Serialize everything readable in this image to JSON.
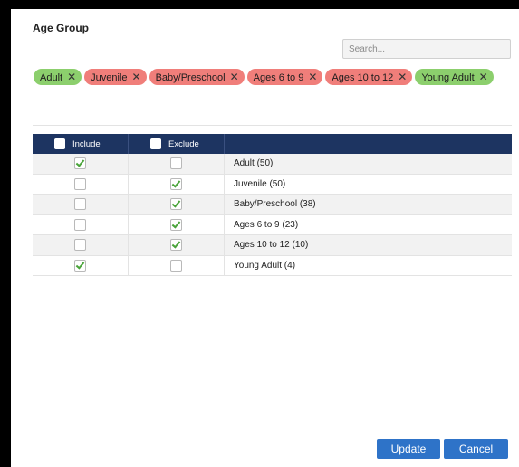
{
  "dialog": {
    "title": "Age Group",
    "search": {
      "placeholder": "Search...",
      "value": ""
    }
  },
  "chips": [
    {
      "label": "Adult",
      "kind": "include"
    },
    {
      "label": "Juvenile",
      "kind": "exclude"
    },
    {
      "label": "Baby/Preschool",
      "kind": "exclude"
    },
    {
      "label": "Ages 6 to 9",
      "kind": "exclude"
    },
    {
      "label": "Ages 10 to 12",
      "kind": "exclude"
    },
    {
      "label": "Young Adult",
      "kind": "include"
    }
  ],
  "chip_remove_glyph": "✕",
  "table": {
    "headers": {
      "include": "Include",
      "exclude": "Exclude"
    },
    "rows": [
      {
        "label": "Adult (50)",
        "include": true,
        "exclude": false
      },
      {
        "label": "Juvenile (50)",
        "include": false,
        "exclude": true
      },
      {
        "label": "Baby/Preschool (38)",
        "include": false,
        "exclude": true
      },
      {
        "label": "Ages 6 to 9 (23)",
        "include": false,
        "exclude": true
      },
      {
        "label": "Ages 10 to 12 (10)",
        "include": false,
        "exclude": true
      },
      {
        "label": "Young Adult (4)",
        "include": true,
        "exclude": false
      }
    ]
  },
  "buttons": {
    "update": "Update",
    "cancel": "Cancel"
  },
  "colors": {
    "include_chip": "#8ccf6d",
    "exclude_chip": "#f07e7a",
    "header_bg": "#1d3461",
    "button_bg": "#2e73c8",
    "check": "#4aa43a"
  }
}
